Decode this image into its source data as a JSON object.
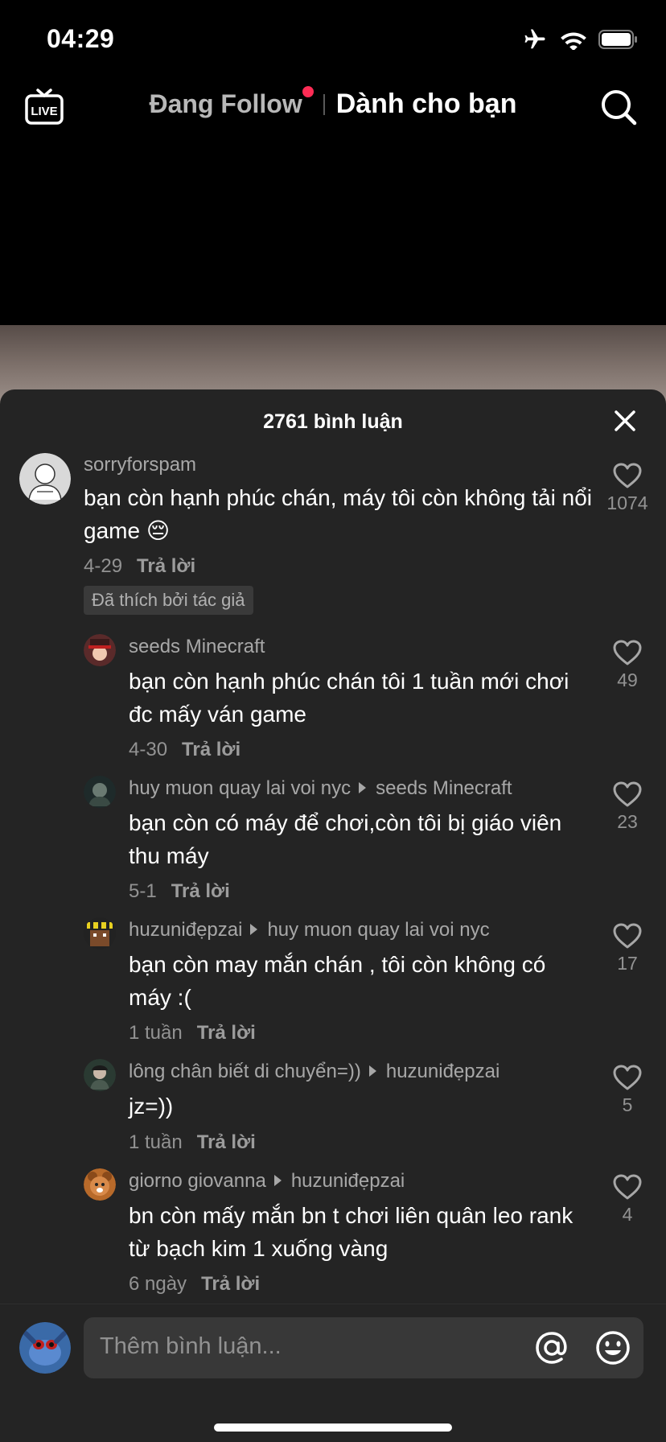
{
  "status_bar": {
    "time": "04:29"
  },
  "top_nav": {
    "tab_following": "Đang Follow",
    "tab_for_you": "Dành cho bạn",
    "live_label": "LIVE"
  },
  "comments_sheet": {
    "count_label": "2761 bình luận",
    "comments": [
      {
        "user": "sorryforspam",
        "reply_to": "",
        "text": "bạn còn hạnh phúc chán, máy tôi còn không tải nổi game 😔",
        "date": "4-29",
        "reply_label": "Trả lời",
        "likes": "1074",
        "liked_by_author": "Đã thích bởi tác giả"
      },
      {
        "user": "seeds Minecraft",
        "reply_to": "",
        "text": "bạn còn hạnh phúc chán tôi 1 tuần mới chơi đc mấy ván game",
        "date": "4-30",
        "reply_label": "Trả lời",
        "likes": "49"
      },
      {
        "user": "huy muon quay lai voi nyc",
        "reply_to": "seeds Minecraft",
        "text": "bạn còn có máy để chơi,còn tôi bị giáo viên thu máy",
        "date": "5-1",
        "reply_label": "Trả lời",
        "likes": "23"
      },
      {
        "user": "huzuniđẹpzai",
        "reply_to": "huy muon quay lai voi nyc",
        "text": "bạn còn may mắn chán , tôi còn không có máy :(",
        "date": "1 tuần",
        "reply_label": "Trả lời",
        "likes": "17"
      },
      {
        "user": "lông chân biết di chuyển=))",
        "reply_to": "huzuniđẹpzai",
        "text": "jz=))",
        "date": "1 tuần",
        "reply_label": "Trả lời",
        "likes": "5"
      },
      {
        "user": "giorno giovanna",
        "reply_to": "huzuniđẹpzai",
        "text": "bn còn mấy mắn bn t chơi liên quân leo rank từ bạch kim 1 xuống vàng",
        "date": "6 ngày",
        "reply_label": "Trả lời",
        "likes": "4"
      }
    ]
  },
  "input_bar": {
    "placeholder": "Thêm bình luận..."
  },
  "colors": {
    "sheet_bg": "#242424",
    "accent_dot": "#fe2c55"
  }
}
